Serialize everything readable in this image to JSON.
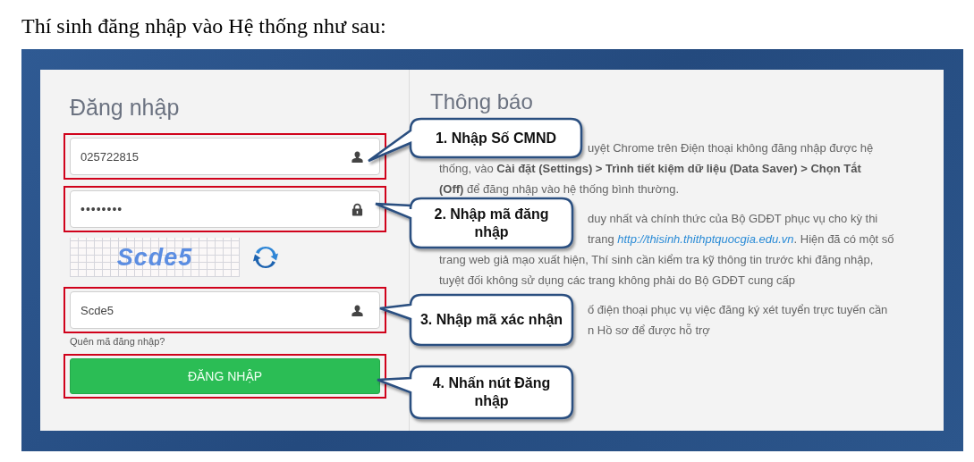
{
  "document": {
    "heading": "Thí sinh đăng nhập vào Hệ thống như sau:"
  },
  "login": {
    "title": "Đăng nhập",
    "fields": [
      {
        "kind": "text",
        "value": "025722815",
        "highlighted": true
      },
      {
        "kind": "password",
        "value": "••••••••",
        "highlighted": true
      }
    ],
    "captcha": {
      "text": "Scde5"
    },
    "code_field": {
      "value": "Scde5",
      "highlighted": true
    },
    "forgot_link": "Quên mã đăng nhập?",
    "submit": {
      "label": "ĐĂNG NHẬP",
      "highlighted": true
    }
  },
  "notice": {
    "title": "Thông báo",
    "paragraphs": [
      {
        "lines": [
          {
            "kind": "after-callout",
            "segments": [
              {
                "kind": "plain",
                "text": "uyệt Chrome trên Điện thoại không đăng nhập được hệ"
              }
            ]
          },
          {
            "kind": "full",
            "segments": [
              {
                "kind": "plain",
                "text": "thống, vào **Cài đặt (Settings) > Trình tiết kiệm dữ liệu (Data Saver) > Chọn Tắt**"
              }
            ]
          },
          {
            "kind": "full",
            "segments": [
              {
                "kind": "plain",
                "text": "**(Off)** để đăng nhập vào hệ thống bình thường."
              }
            ]
          }
        ]
      },
      {
        "lines": [
          {
            "kind": "after-callout",
            "segments": [
              {
                "kind": "plain",
                "text": "duy nhất và chính thức của Bộ GDĐT phục vụ cho kỳ thi"
              }
            ]
          },
          {
            "kind": "after-callout",
            "segments": [
              {
                "kind": "plain",
                "text": "trang "
              },
              {
                "kind": "link",
                "text": "http://thisinh.thithptquocgia.edu.vn"
              },
              {
                "kind": "plain",
                "text": ". Hiện đã có một số"
              }
            ]
          },
          {
            "kind": "full",
            "segments": [
              {
                "kind": "plain",
                "text": "trang web giả mạo xuất hiện, Thí sinh cần kiểm tra kỹ thông tin trước khi đăng nhập,"
              }
            ]
          },
          {
            "kind": "full",
            "segments": [
              {
                "kind": "plain",
                "text": "tuyệt đối không sử dụng các trang không phải do Bộ GDĐT cung cấp"
              }
            ]
          }
        ]
      },
      {
        "lines": [
          {
            "kind": "after-callout",
            "segments": [
              {
                "kind": "plain",
                "text": "ố điện thoại phục vụ việc đăng ký xét tuyển trực tuyến cần"
              }
            ]
          },
          {
            "kind": "after-callout",
            "segments": [
              {
                "kind": "plain",
                "text": "n Hồ sơ để được hỗ trợ"
              }
            ]
          }
        ]
      }
    ]
  },
  "callouts": [
    {
      "text": "1. Nhập Số CMND"
    },
    {
      "text": "2. Nhập mã đăng nhập"
    },
    {
      "text": "3. Nhập mã xác nhận"
    },
    {
      "text": "4. Nhấn nút Đăng nhập"
    }
  ]
}
